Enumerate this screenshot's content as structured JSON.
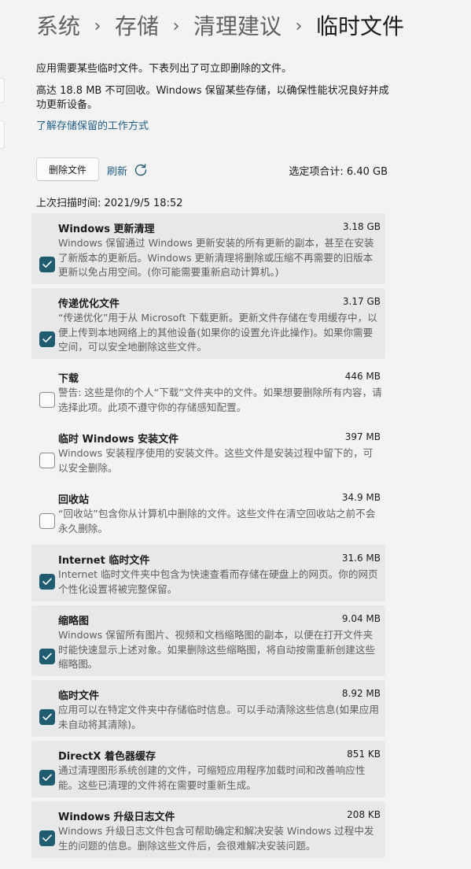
{
  "breadcrumb": {
    "items": [
      "系统",
      "存储",
      "清理建议"
    ],
    "current": "临时文件",
    "separator": "›"
  },
  "intro": {
    "line1": "应用需要某些临时文件。下表列出了可立即删除的文件。",
    "line2": "高达 18.8 MB 不可回收。Windows 保留某些存储，以确保性能状况良好并成功更新设备。"
  },
  "learn_link": "了解存储保留的工作方式",
  "actions": {
    "delete_label": "删除文件",
    "refresh_label": "刷新",
    "refresh_icon": "refresh-icon"
  },
  "selected_total": "选定项合计: 6.40 GB",
  "last_scan": "上次扫描时间: 2021/9/5 18:52",
  "colors": {
    "accent": "#1f5c6f",
    "link": "#1f5c88",
    "item_bg": "#e6e8e9",
    "page_bg": "#f3f3f3"
  },
  "items": [
    {
      "title": "Windows 更新清理",
      "size": "3.18 GB",
      "checked": true,
      "desc": "Windows 保留通过 Windows 更新安装的所有更新的副本，甚至在安装了新版本的更新后。Windows 更新清理将删除或压缩不再需要的旧版本更新以免占用空间。(你可能需要重新启动计算机。)"
    },
    {
      "title": "传递优化文件",
      "size": "3.17 GB",
      "checked": true,
      "desc": "“传递优化”用于从 Microsoft 下载更新。更新文件存储在专用缓存中，以便上传到本地网络上的其他设备(如果你的设置允许此操作)。如果你需要空间，可以安全地删除这些文件。"
    },
    {
      "title": "下载",
      "size": "446 MB",
      "checked": false,
      "desc": "警告: 这些是你的个人“下载”文件夹中的文件。如果想要删除所有内容，请选择此项。此项不遵守你的存储感知配置。"
    },
    {
      "title": "临时 Windows 安装文件",
      "size": "397 MB",
      "checked": false,
      "desc": "Windows 安装程序使用的安装文件。这些文件是安装过程中留下的，可以安全删除。"
    },
    {
      "title": "回收站",
      "size": "34.9 MB",
      "checked": false,
      "desc": "“回收站”包含你从计算机中删除的文件。这些文件在清空回收站之前不会永久删除。"
    },
    {
      "title": "Internet 临时文件",
      "size": "31.6 MB",
      "checked": true,
      "desc": "Internet 临时文件夹中包含为快速查看而存储在硬盘上的网页。你的网页个性化设置将被完整保留。"
    },
    {
      "title": "缩略图",
      "size": "9.04 MB",
      "checked": true,
      "desc": "Windows 保留所有图片、视频和文档缩略图的副本，以便在打开文件夹时能快速显示上述对象。如果删除这些缩略图，将自动按需重新创建这些缩略图。"
    },
    {
      "title": "临时文件",
      "size": "8.92 MB",
      "checked": true,
      "desc": "应用可以在特定文件夹中存储临时信息。可以手动清除这些信息(如果应用未自动将其清除)。"
    },
    {
      "title": "DirectX 着色器缓存",
      "size": "851 KB",
      "checked": true,
      "desc": "通过清理图形系统创建的文件，可缩短应用程序加载时间和改善响应性能。这些已清理的文件将在需要时重新生成。"
    },
    {
      "title": "Windows 升级日志文件",
      "size": "208 KB",
      "checked": true,
      "desc": "Windows 升级日志文件包含可帮助确定和解决安装 Windows 过程中发生的问题的信息。删除这些文件后，会很难解决安装问题。"
    }
  ]
}
